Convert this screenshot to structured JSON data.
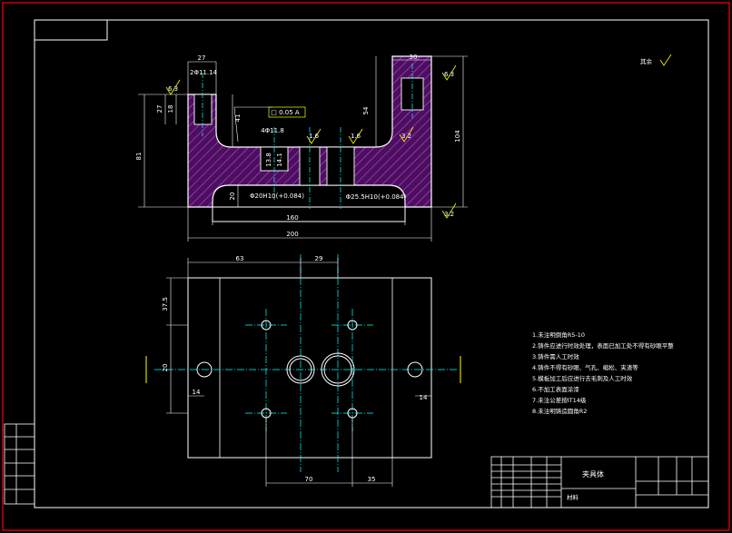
{
  "drawing": {
    "section_view": {
      "dims": {
        "top_left_width": "27",
        "counterbore_left": "2Φ11.14",
        "right_width": "30",
        "left_depth_a": "18",
        "left_depth_b": "27",
        "slot_depth": "41",
        "left_total": "81",
        "right_depth": "54",
        "right_total": "104",
        "bottom_step": "20",
        "inner_width": "160",
        "total_width": "200",
        "flatness": "□ 0.05 A",
        "center_bore": "4Φ11.8",
        "bore_depth_a": "13.8",
        "bore_depth_b": "14.1",
        "bore_left": "Φ20H10(+0.084)",
        "bore_right": "Φ25.5H10(+0.084)"
      },
      "surface_marks": {
        "left_top": "6.3",
        "right_top": "6.3",
        "center_left": "1.6",
        "center_right": "1.6",
        "right_mid": "3.2",
        "right_bottom": "3.2"
      }
    },
    "plan_view": {
      "dims": {
        "top_left": "63",
        "top_mid": "29",
        "left_upper": "37.5",
        "left_mid": "20",
        "left_low": "14",
        "right_low": "14",
        "bottom_a": "70",
        "bottom_b": "35"
      }
    },
    "notes": [
      "1.未注明倒角R5-10",
      "2.铸件应进行时效处理，表面已加工处不得有砂眼平整",
      "3.铸件需人工时效",
      "4.铸件不得有砂眼、气孔、缩松、夹渣等",
      "5.模板加工后应进行去毛刺及人工时效",
      "6.不加工表面涂漆",
      "7.未注公差按IT14级",
      "8.未注明铸造圆角R2"
    ],
    "other_roughness": "其余",
    "title_block": {
      "part_name": "夹具体",
      "material": "材料"
    }
  },
  "colors": {
    "frame": "#ff0000",
    "outline": "#ffffff",
    "center": "#00ffff",
    "hatch": "#d040d0",
    "roughness": "#ffff00",
    "marks": "#00ff00"
  }
}
